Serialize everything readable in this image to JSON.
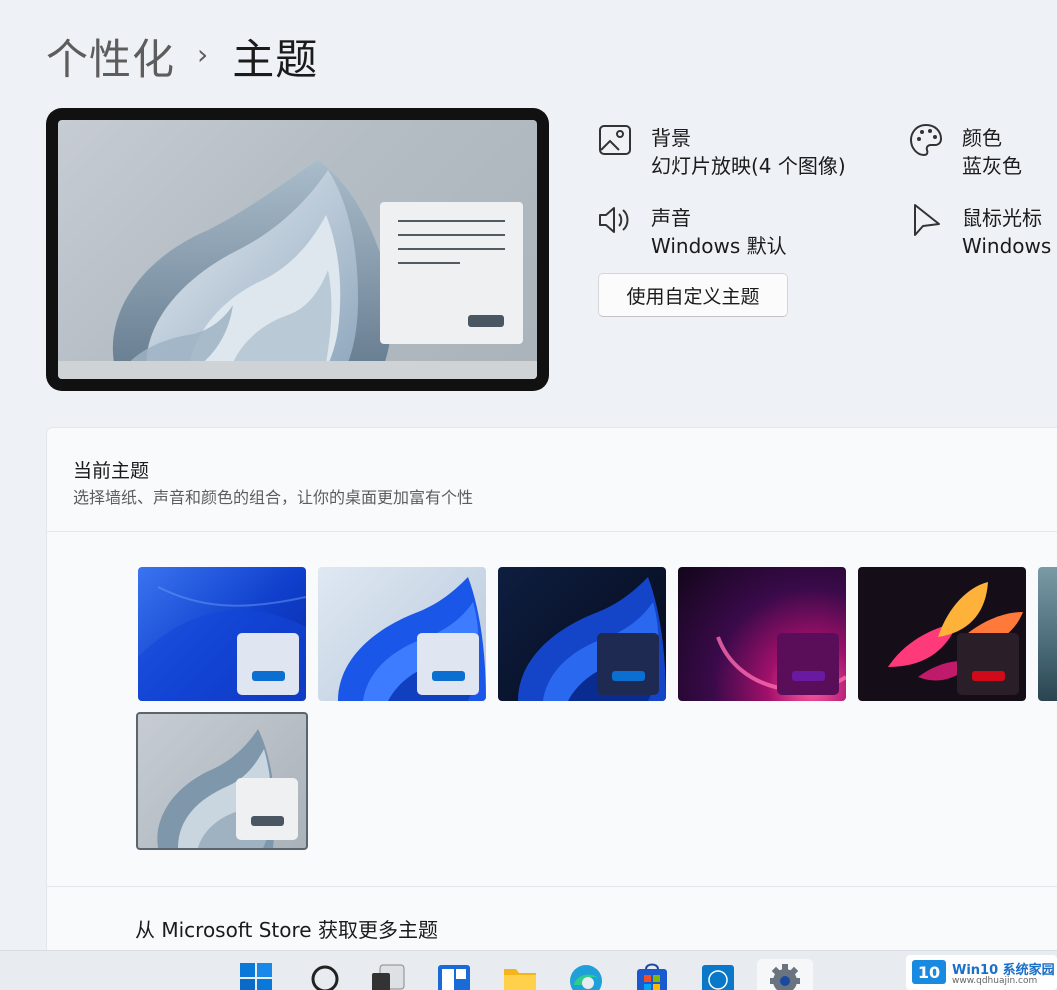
{
  "breadcrumb": {
    "parent": "个性化",
    "separator": "›",
    "current": "主题"
  },
  "theme_info": {
    "background": {
      "label": "背景",
      "value": "幻灯片放映(4 个图像)",
      "icon": "image-icon"
    },
    "color": {
      "label": "颜色",
      "value": "蓝灰色",
      "icon": "palette-icon"
    },
    "sound": {
      "label": "声音",
      "value": "Windows 默认",
      "icon": "speaker-icon"
    },
    "cursor": {
      "label": "鼠标光标",
      "value": "Windows 默认",
      "icon": "cursor-icon"
    }
  },
  "custom_theme_button": "使用自定义主题",
  "current_theme": {
    "title": "当前主题",
    "subtitle": "选择墙纸、声音和颜色的组合，让你的桌面更加富有个性"
  },
  "themes": [
    {
      "name": "windows-blue",
      "bg": "#1a4fd6",
      "window_color": "#dfe6f1",
      "button_color": "#0a6fd0"
    },
    {
      "name": "windows-light",
      "bg": "#b8c8dc",
      "window_color": "#dfe6f1",
      "button_color": "#0a6fd0"
    },
    {
      "name": "windows-dark",
      "bg": "#0b1a3a",
      "window_color": "#1e2a52",
      "button_color": "#0a6fd0"
    },
    {
      "name": "glow",
      "bg": "#3a0a4a",
      "window_color": "#5a0e5a",
      "button_color": "#6a1aa0"
    },
    {
      "name": "captured-motion",
      "bg": "#150e18",
      "window_color": "#2a1e28",
      "button_color": "#d10a1a"
    },
    {
      "name": "sunrise",
      "bg": "#4a6a78"
    },
    {
      "name": "flow-gray",
      "bg": "#aab2ba",
      "window_color": "#eef0f2",
      "button_color": "#4a5661",
      "selected": true
    }
  ],
  "store_link": "从 Microsoft Store 获取更多主题",
  "taskbar": {
    "items": [
      "start-icon",
      "search-icon",
      "task-view-icon",
      "widgets-icon",
      "file-explorer-icon",
      "edge-icon",
      "store-icon",
      "dell-icon",
      "settings-icon"
    ]
  },
  "watermark": {
    "logo": "10",
    "title": "Win10 系统家园",
    "url": "www.qdhuajin.com"
  }
}
